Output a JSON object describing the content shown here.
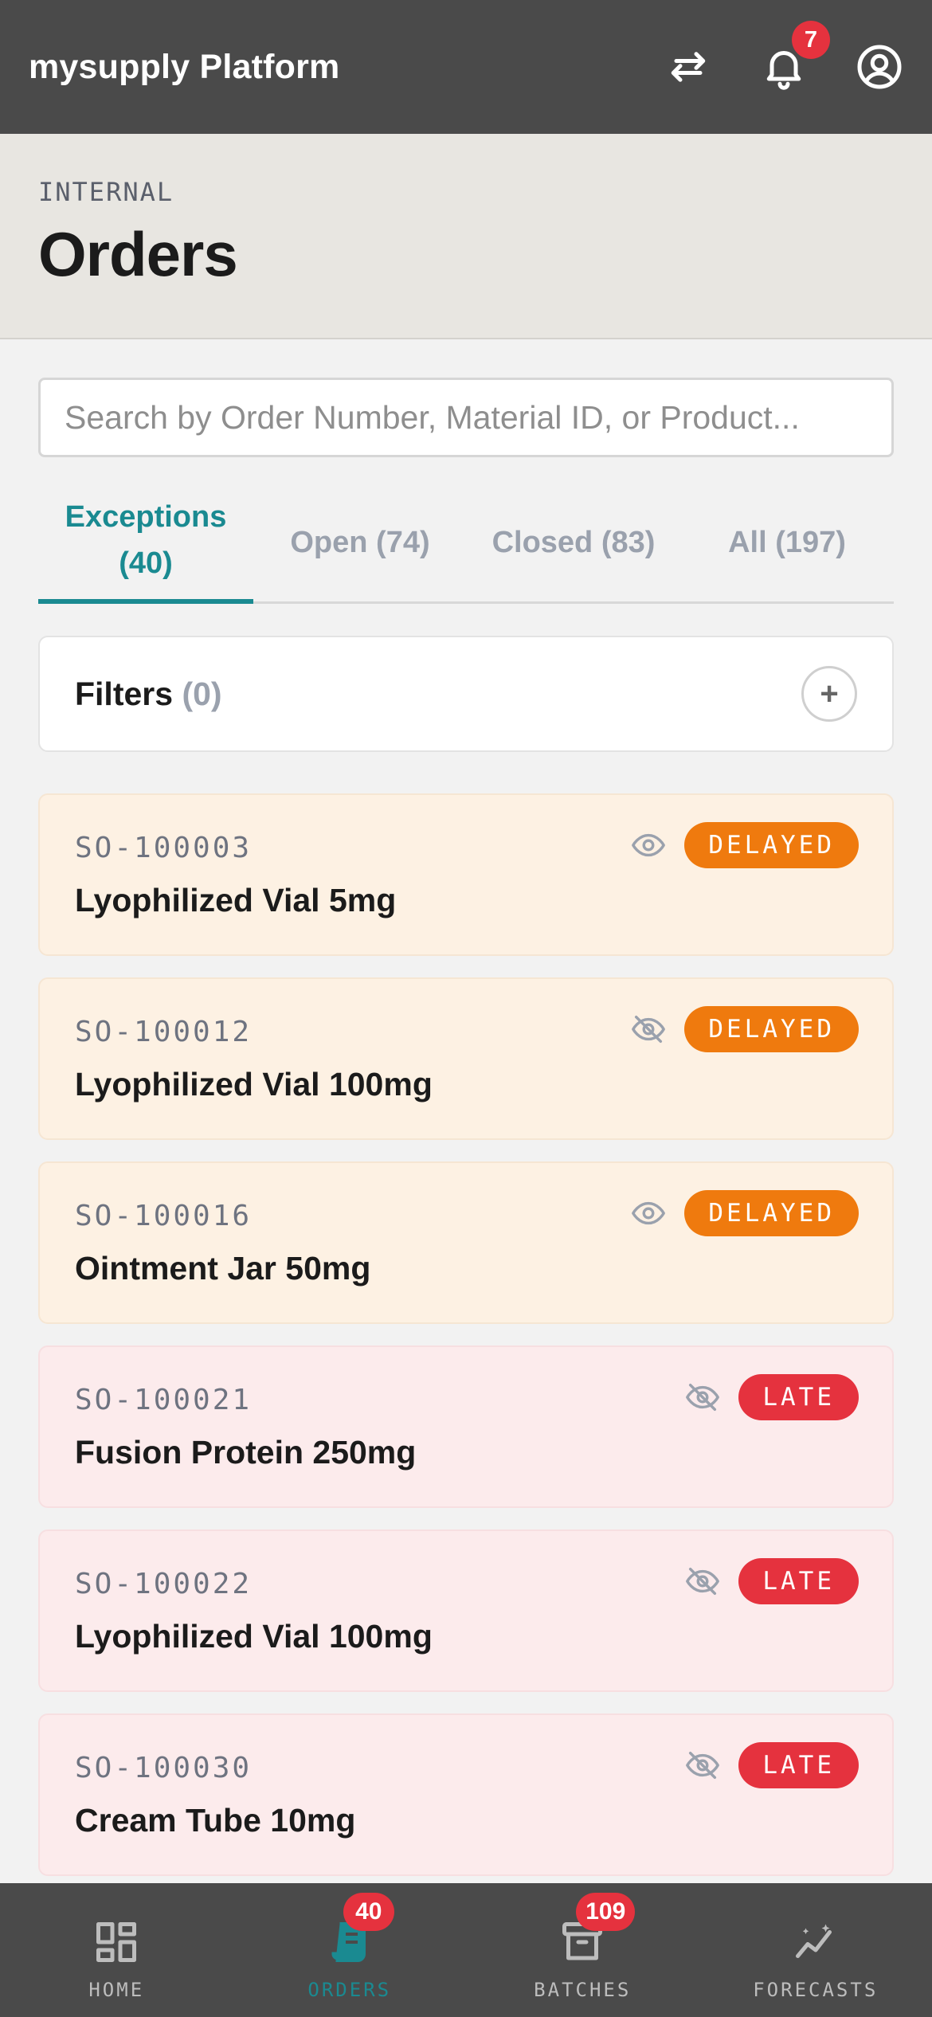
{
  "app": {
    "title": "mysupply Platform",
    "notifications_count": "7"
  },
  "header": {
    "eyebrow": "INTERNAL",
    "title": "Orders"
  },
  "search": {
    "placeholder": "Search by Order Number, Material ID, or Product..."
  },
  "tabs": [
    {
      "label": "Exceptions",
      "count": "(40)"
    },
    {
      "label": "Open",
      "count": "(74)"
    },
    {
      "label": "Closed",
      "count": "(83)"
    },
    {
      "label": "All",
      "count": "(197)"
    }
  ],
  "filters": {
    "label": "Filters",
    "count": "(0)",
    "add_icon": "+"
  },
  "orders": [
    {
      "number": "SO-100003",
      "product": "Lyophilized Vial 5mg",
      "status": "DELAYED",
      "watch": "eye-icon"
    },
    {
      "number": "SO-100012",
      "product": "Lyophilized Vial 100mg",
      "status": "DELAYED",
      "watch": "eye-off-icon"
    },
    {
      "number": "SO-100016",
      "product": "Ointment Jar 50mg",
      "status": "DELAYED",
      "watch": "eye-icon"
    },
    {
      "number": "SO-100021",
      "product": "Fusion Protein 250mg",
      "status": "LATE",
      "watch": "eye-off-icon"
    },
    {
      "number": "SO-100022",
      "product": "Lyophilized Vial 100mg",
      "status": "LATE",
      "watch": "eye-off-icon"
    },
    {
      "number": "SO-100030",
      "product": "Cream Tube 10mg",
      "status": "LATE",
      "watch": "eye-off-icon"
    }
  ],
  "bottom_nav": [
    {
      "label": "HOME",
      "icon": "dashboard-icon",
      "badge": ""
    },
    {
      "label": "ORDERS",
      "icon": "orders-icon",
      "badge": "40"
    },
    {
      "label": "BATCHES",
      "icon": "archive-box-icon",
      "badge": "109"
    },
    {
      "label": "FORECASTS",
      "icon": "trend-chart-icon",
      "badge": ""
    }
  ],
  "colors": {
    "accent": "#1a8a91",
    "delayed": "#ef7a0e",
    "late": "#e5323e",
    "bar": "#4a4a4a"
  }
}
